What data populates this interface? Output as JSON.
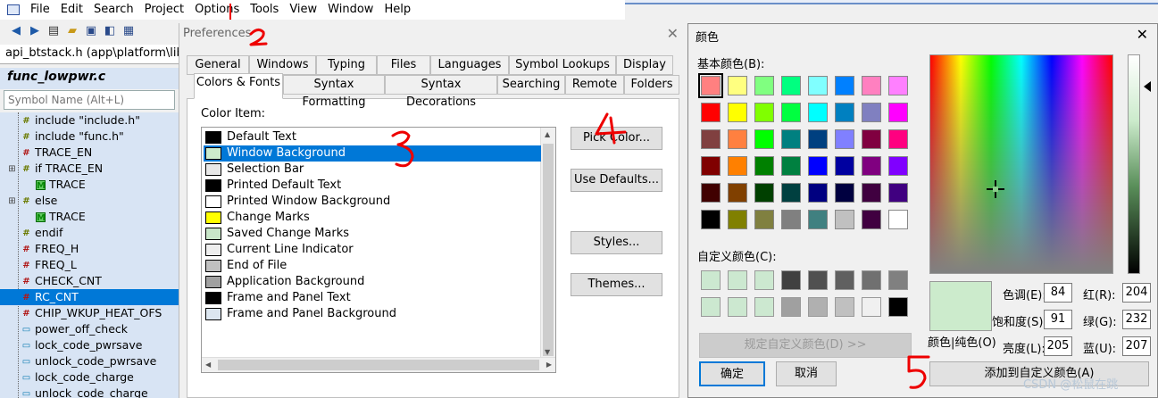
{
  "menubar": {
    "items": [
      "File",
      "Edit",
      "Search",
      "Project",
      "Options",
      "Tools",
      "View",
      "Window",
      "Help"
    ]
  },
  "toolbar": {
    "icons": [
      "back-arrow-icon",
      "forward-arrow-icon",
      "new-file-icon",
      "open-folder-icon",
      "save-icon",
      "save-all-icon",
      "close-file-icon"
    ]
  },
  "file_tab": "api_btstack.h (app\\platform\\libs)",
  "function_box": "func_lowpwr.c",
  "symbol_search": {
    "placeholder": "Symbol Name (Alt+L)"
  },
  "symbols": [
    {
      "label": "include \"include.h\"",
      "icon": "inc",
      "indent": 1
    },
    {
      "label": "include \"func.h\"",
      "icon": "inc",
      "indent": 1
    },
    {
      "label": "TRACE_EN",
      "icon": "def",
      "indent": 1
    },
    {
      "label": "if TRACE_EN",
      "icon": "inc",
      "indent": 1,
      "expand": true
    },
    {
      "label": "TRACE",
      "icon": "mac",
      "indent": 2
    },
    {
      "label": "else",
      "icon": "inc",
      "indent": 1,
      "expand": true
    },
    {
      "label": "TRACE",
      "icon": "mac",
      "indent": 2
    },
    {
      "label": "endif",
      "icon": "inc",
      "indent": 1
    },
    {
      "label": "FREQ_H",
      "icon": "def",
      "indent": 1
    },
    {
      "label": "FREQ_L",
      "icon": "def",
      "indent": 1
    },
    {
      "label": "CHECK_CNT",
      "icon": "def",
      "indent": 1
    },
    {
      "label": "RC_CNT",
      "icon": "def",
      "indent": 1,
      "selected": true
    },
    {
      "label": "CHIP_WKUP_HEAT_OFS",
      "icon": "def",
      "indent": 1
    },
    {
      "label": "power_off_check",
      "icon": "fn",
      "indent": 1
    },
    {
      "label": "lock_code_pwrsave",
      "icon": "fn",
      "indent": 1
    },
    {
      "label": "unlock_code_pwrsave",
      "icon": "fn",
      "indent": 1
    },
    {
      "label": "lock_code_charge",
      "icon": "fn",
      "indent": 1
    },
    {
      "label": "unlock_code_charge",
      "icon": "fn",
      "indent": 1
    }
  ],
  "preferences": {
    "title": "Preferences",
    "tabs_row1": [
      "General",
      "Windows",
      "Typing",
      "Files",
      "Languages",
      "Symbol Lookups",
      "Display"
    ],
    "tabs_row2": [
      "Colors & Fonts",
      "Syntax Formatting",
      "Syntax Decorations",
      "Searching",
      "Remote",
      "Folders"
    ],
    "active_tab": "Colors & Fonts",
    "color_item_label": "Color Item:",
    "color_items": [
      {
        "label": "Default Text",
        "color": "#000000"
      },
      {
        "label": "Window Background",
        "color": "#ccebcc",
        "selected": true
      },
      {
        "label": "Selection Bar",
        "color": "#e8e8e8"
      },
      {
        "label": "Printed Default Text",
        "color": "#000000"
      },
      {
        "label": "Printed Window Background",
        "color": "#ffffff"
      },
      {
        "label": "Change Marks",
        "color": "#ffff00"
      },
      {
        "label": "Saved Change Marks",
        "color": "#c8e6c8"
      },
      {
        "label": "Current Line Indicator",
        "color": "#eeeeee"
      },
      {
        "label": "End of File",
        "color": "#c0c0c0"
      },
      {
        "label": "Application Background",
        "color": "#a0a0a0"
      },
      {
        "label": "Frame and Panel Text",
        "color": "#000000"
      },
      {
        "label": "Frame and Panel Background",
        "color": "#dce6f0"
      }
    ],
    "buttons": {
      "pick_color": "Pick Color...",
      "use_defaults": "Use Defaults...",
      "styles": "Styles...",
      "themes": "Themes..."
    }
  },
  "color_dialog": {
    "title": "颜色",
    "basic_label": "基本颜色(B):",
    "custom_label": "自定义颜色(C):",
    "basic_colors": [
      "#ff8080",
      "#ffff80",
      "#80ff80",
      "#00ff80",
      "#80ffff",
      "#0080ff",
      "#ff80c0",
      "#ff80ff",
      "#ff0000",
      "#ffff00",
      "#80ff00",
      "#00ff40",
      "#00ffff",
      "#0080c0",
      "#8080c0",
      "#ff00ff",
      "#804040",
      "#ff8040",
      "#00ff00",
      "#008080",
      "#004080",
      "#8080ff",
      "#800040",
      "#ff0080",
      "#800000",
      "#ff8000",
      "#008000",
      "#008040",
      "#0000ff",
      "#0000a0",
      "#800080",
      "#8000ff",
      "#400000",
      "#804000",
      "#004000",
      "#004040",
      "#000080",
      "#000040",
      "#400040",
      "#400080",
      "#000000",
      "#808000",
      "#808040",
      "#808080",
      "#408080",
      "#c0c0c0",
      "#400040",
      "#ffffff"
    ],
    "custom_colors": [
      "#cce8d0",
      "#cce8d0",
      "#cce8d0",
      "#404040",
      "#505050",
      "#606060",
      "#707070",
      "#808080",
      "#cce8d0",
      "#cce8d0",
      "#cce8d0",
      "#a0a0a0",
      "#b0b0b0",
      "#c0c0c0",
      "#f0f0f0",
      "#000000"
    ],
    "define_custom": "规定自定义颜色(D) >>",
    "preview_label": "颜色|纯色(O)",
    "fields": {
      "hue_label": "色调(E):",
      "hue": "84",
      "sat_label": "饱和度(S):",
      "sat": "91",
      "lum_label": "亮度(L):",
      "lum": "205",
      "red_label": "红(R):",
      "red": "204",
      "green_label": "绿(G):",
      "green": "232",
      "blue_label": "蓝(U):",
      "blue": "207"
    },
    "ok": "确定",
    "cancel": "取消",
    "add_custom": "添加到自定义颜色(A)"
  },
  "watermark": "CSDN @松鼠在跳"
}
